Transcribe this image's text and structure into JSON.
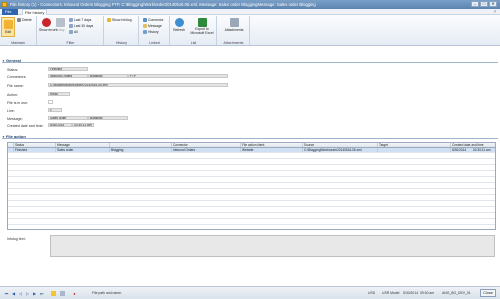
{
  "window": {
    "title": "File history (1) - Connectors: Inbound Orders Blogging FTP, C:\\Blogging\\Work\\order20140516.05.xml, Message: Sales order BloggingMessage: Sales order Blogging",
    "minimize": "–",
    "maximize": "□",
    "close": "✕"
  },
  "menu": {
    "file": "File",
    "tab": "File history",
    "help": "?"
  },
  "ribbon": {
    "maintain": {
      "label": "Maintain",
      "edit": "Edit",
      "delete": "Delete"
    },
    "filter": {
      "label": "Filter",
      "show_errors": "Show errors",
      "today": "Today",
      "last7": "Last 7 days",
      "last30": "Last 30 days",
      "all": "All"
    },
    "history": {
      "label": "History",
      "show_infolog": "Show Infolog"
    },
    "linked": {
      "label": "Linked",
      "connector": "Connector",
      "message": "Message",
      "history": "History"
    },
    "list": {
      "label": "List",
      "refresh": "Refresh",
      "export": "Export to Microsoft Excel"
    },
    "attachments": {
      "label": "Attachments",
      "attachments": "Attachments"
    }
  },
  "general": {
    "header": "General",
    "status_label": "Status:",
    "status_value": "Finished",
    "connectors_label": "Connectors:",
    "connectors_values": [
      "Inbound Orders",
      "Blogging",
      "FTP"
    ],
    "filename_label": "File name:",
    "filename_value": "C:\\Blogging\\Work\\order20140516.05.xml",
    "action_label": "Action:",
    "action_value": "Read",
    "fileinuse_label": "File is in use:",
    "line_label": "Line:",
    "line_value": "1",
    "message_label": "Message:",
    "message_values": [
      "Sales order",
      "Blogging"
    ],
    "created_label": "Created date and time:",
    "created_date": "5/30/2014",
    "created_time": "02:30:11 am"
  },
  "file_action": {
    "header": "File action",
    "columns": [
      "Status",
      "Message",
      "",
      "Connector",
      "File action ident",
      "Source",
      "Target",
      "Created date and time"
    ],
    "rows": [
      [
        "Finished",
        "Sales order",
        "Blogging",
        "Inbound Orders",
        "Website",
        "C:\\Blogging\\Work\\order20140516.05.xml",
        "",
        "5/30/2014",
        "02:30:11 am"
      ]
    ]
  },
  "infolog": {
    "label": "Infolog text:"
  },
  "statusbar": {
    "hint": "File path and name.",
    "currency": "USD",
    "model": "USR Model",
    "date": "5/30/2014",
    "time": "09:00 am",
    "company": "ANG_BG_DEV_01",
    "close": "Close"
  },
  "colors": {
    "accent": "#2e64b0",
    "ribbon": "#e6ecf4",
    "selection": "#cfe0f4"
  }
}
